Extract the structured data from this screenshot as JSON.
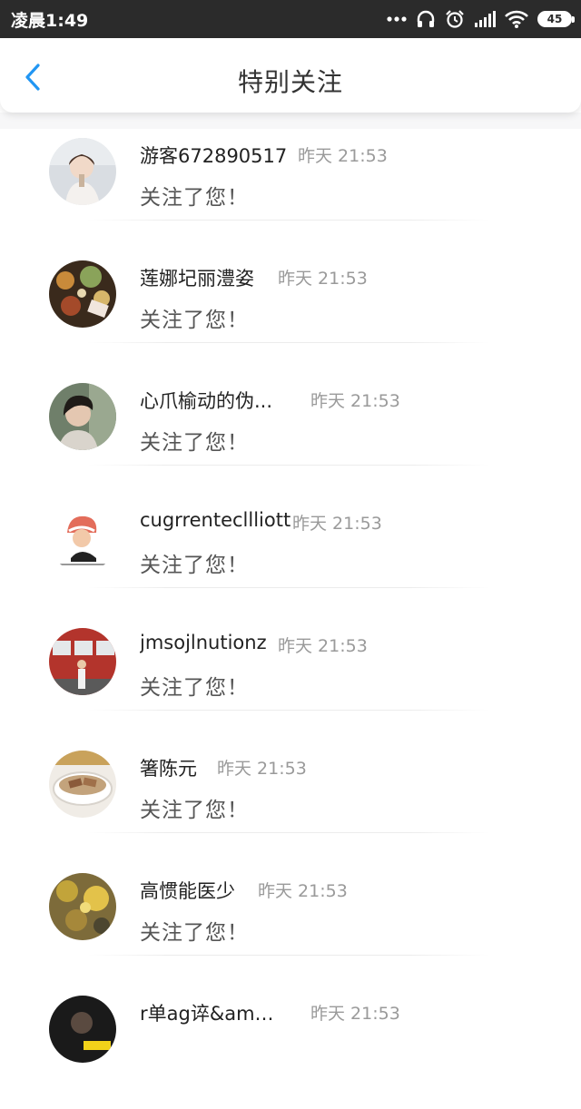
{
  "status_bar": {
    "time": "凌晨1:49",
    "battery": "45"
  },
  "header": {
    "title": "特别关注",
    "accent_color": "#2196f3"
  },
  "items": [
    {
      "name": "游客672890517",
      "time": "昨天 21:53",
      "message": "关注了您！"
    },
    {
      "name": "莲娜圮丽澧姿",
      "time": "昨天 21:53",
      "message": "关注了您！"
    },
    {
      "name": "心爪榆动的伪...",
      "time": "昨天 21:53",
      "message": "关注了您！"
    },
    {
      "name": "cugrrentecllliott",
      "time": "昨天 21:53",
      "message": "关注了您！"
    },
    {
      "name": "jmsojlnutionz",
      "time": "昨天 21:53",
      "message": "关注了您！"
    },
    {
      "name": "箸陈元",
      "time": "昨天 21:53",
      "message": "关注了您！"
    },
    {
      "name": "高惯能医少",
      "time": "昨天 21:53",
      "message": "关注了您！"
    },
    {
      "name": "r单ag谇&amp;...",
      "time": "昨天 21:53",
      "message": ""
    }
  ]
}
